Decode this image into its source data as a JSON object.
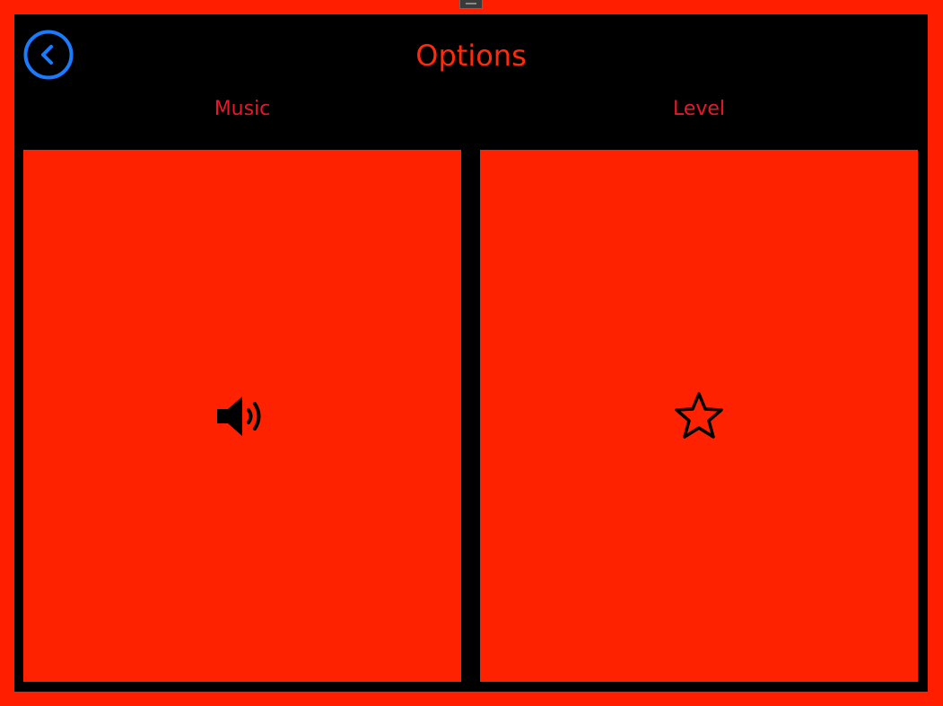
{
  "header": {
    "title": "Options"
  },
  "sections": {
    "music": {
      "label": "Music",
      "icon": "speaker-volume-icon"
    },
    "level": {
      "label": "Level",
      "icon": "star-outline-icon"
    }
  },
  "colors": {
    "background": "#ff1e00",
    "frame": "#000000",
    "tile": "#ff2200",
    "title_text": "#ff2a0a",
    "label_text": "#e8182a",
    "back_button": "#1a7bff",
    "icon": "#000000"
  },
  "back_button": {
    "icon": "chevron-left-circle-icon"
  }
}
